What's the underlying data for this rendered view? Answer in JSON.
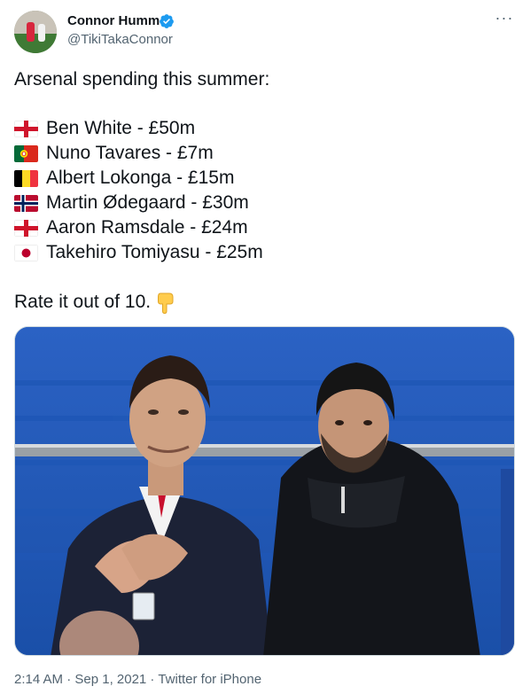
{
  "tweet": {
    "author_name": "Connor Humm",
    "author_handle": "@TikiTakaConnor",
    "headline": "Arsenal spending this summer:",
    "players": [
      {
        "flag": "england-flag",
        "text": "Ben White - £50m"
      },
      {
        "flag": "portugal-flag",
        "text": "Nuno Tavares - £7m"
      },
      {
        "flag": "belgium-flag",
        "text": "Albert Lokonga - £15m"
      },
      {
        "flag": "norway-flag",
        "text": "Martin Ødegaard - £30m"
      },
      {
        "flag": "england-flag",
        "text": "Aaron Ramsdale - £24m"
      },
      {
        "flag": "japan-flag",
        "text": "Takehiro Tomiyasu - £25m"
      }
    ],
    "rate_line": "Rate it out of 10.",
    "rate_emoji": "pointing-down-icon",
    "timestamp": "2:14 AM · Sep 1, 2021 · Twitter for iPhone",
    "more_label": "···"
  },
  "colors": {
    "verified": "#1d9bf0",
    "secondary_text": "#536471",
    "stadium_blue": "#1c5dbe"
  }
}
